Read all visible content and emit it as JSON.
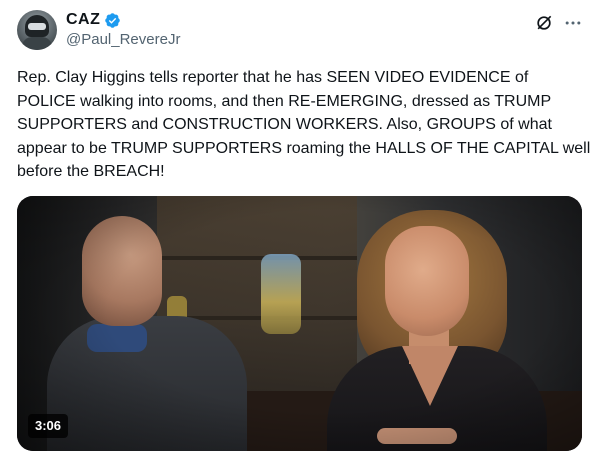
{
  "author": {
    "display_name": "CAZ",
    "handle": "@Paul_ReverеJr",
    "verified": true,
    "verified_color": "#1d9bf0"
  },
  "header_icons": [
    "grok-icon",
    "more-icon"
  ],
  "tweet": {
    "text": "Rep. Clay Higgins tells reporter that he has SEEN VIDEO EVIDENCE of POLICE walking into rooms, and then RE-EMERGING, dressed as TRUMP SUPPORTERS and CONSTRUCTION WORKERS. Also, GROUPS of what appear to be TRUMP SUPPORTERS roaming the HALLS OF THE CAPITAL well before the BREACH!"
  },
  "media": {
    "type": "video",
    "duration": "3:06"
  },
  "colors": {
    "text_primary": "#0f1419",
    "text_secondary": "#536471",
    "duration_badge_bg": "#000000"
  }
}
